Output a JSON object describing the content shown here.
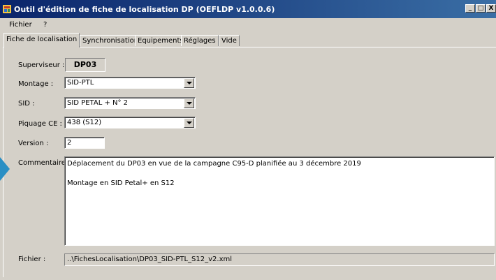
{
  "window": {
    "title": "Outil d'édition de fiche de localisation DP (OEFLDP v1.0.0.6)",
    "controls": [
      "_",
      "□",
      "X"
    ]
  },
  "menu": {
    "items": [
      "Fichier",
      "?"
    ]
  },
  "tabs": [
    {
      "label": "Fiche de localisation",
      "active": true
    },
    {
      "label": "Synchronisation"
    },
    {
      "label": "Equipements"
    },
    {
      "label": "Réglages"
    },
    {
      "label": "Vide"
    }
  ],
  "form": {
    "superviseur_label": "Superviseur :",
    "superviseur_value": "DP03",
    "montage_label": "Montage :",
    "montage_value": "SID-PTL",
    "sid_label": "SID :",
    "sid_value": "SID PETAL + N° 2",
    "piquage_label": "Piquage CE :",
    "piquage_value": "438 (S12)",
    "version_label": "Version :",
    "version_value": "2",
    "commentaire_label": "Commentaire :",
    "commentaire_value": "Déplacement du DP03 en vue de la campagne C95-D planifiée au 3 décembre 2019\n\nMontage en SID Petal+ en S12",
    "fichier_label": "Fichier :",
    "fichier_value": "..\\FichesLocalisation\\DP03_SID-PTL_S12_v2.xml"
  },
  "colors": {
    "titlebar": "#0a246a",
    "accent_arrow": "#2a8fc4",
    "window_bg": "#d4d0c8"
  },
  "icons": [
    "app-icon",
    "dropdown-arrow-icon",
    "side-arrow-icon"
  ]
}
